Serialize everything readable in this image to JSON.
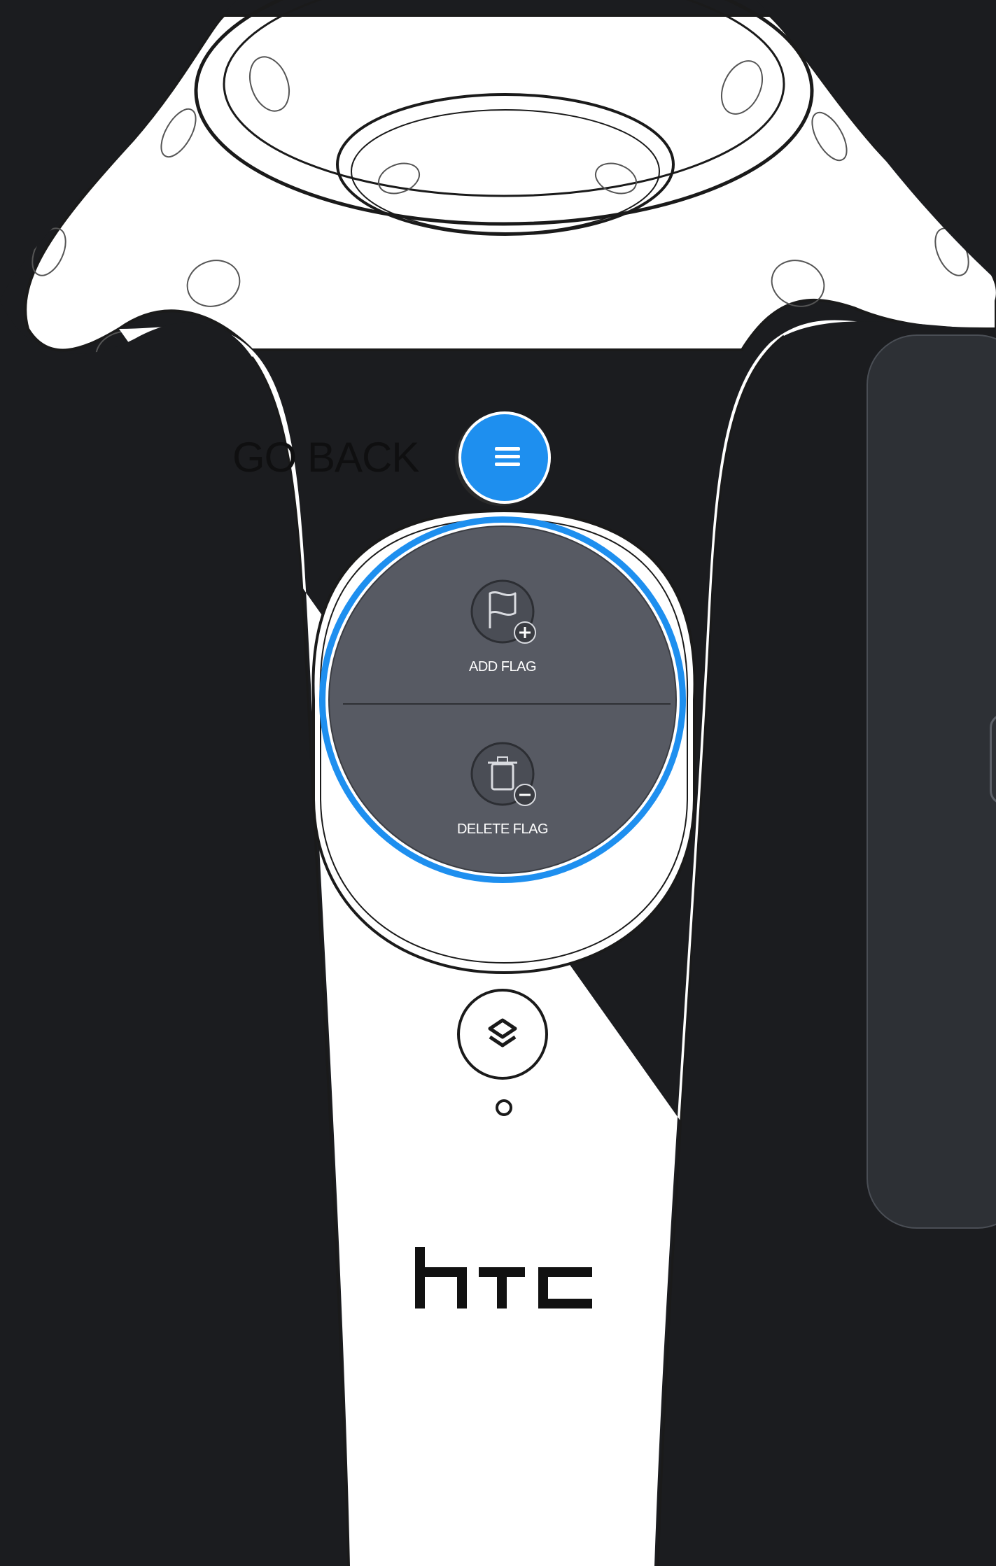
{
  "controller": {
    "brand": "htc"
  },
  "nav": {
    "go_back_label": "GO BACK",
    "menu_icon": "hamburger-menu-icon"
  },
  "touchpad": {
    "top_action": {
      "label": "ADD FLAG",
      "icon": "flag-add-icon"
    },
    "bottom_action": {
      "label": "DELETE FLAG",
      "icon": "trash-remove-icon"
    }
  },
  "system_button": {
    "icon": "layers-icon"
  },
  "colors": {
    "background": "#1b1c1f",
    "controller_body": "#ffffff",
    "accent_blue": "#1e8fef",
    "touchpad_fill": "#575a63",
    "panel_fill": "#2d3035"
  }
}
